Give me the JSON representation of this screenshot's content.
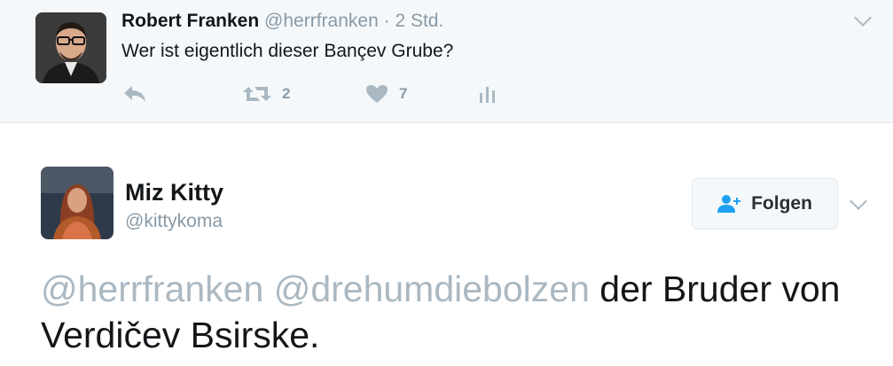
{
  "parent_tweet": {
    "author_name": "Robert Franken",
    "author_handle": "@herrfranken",
    "separator": " · ",
    "time": "2 Std.",
    "text": "Wer ist eigentlich dieser Bançev Grube?",
    "retweet_count": "2",
    "like_count": "7",
    "icons": [
      "reply-icon",
      "retweet-icon",
      "heart-icon",
      "analytics-icon",
      "chevron-down-icon"
    ]
  },
  "main_tweet": {
    "author_name": "Miz Kitty",
    "author_handle": "@kittykoma",
    "follow_label": "Folgen",
    "mention_1": "@herrfranken",
    "mention_2": "@drehumdiebolzen",
    "body_text": "der Bruder von Verdičev Bsirske.",
    "icons": [
      "follow-person-icon",
      "chevron-down-icon"
    ]
  },
  "colors": {
    "parent_background": "#f5f8fa",
    "muted_text": "#8899a6",
    "mention": "#aab8c2",
    "icon_gray": "#aab8c2",
    "follow_icon": "#1da1f2"
  }
}
